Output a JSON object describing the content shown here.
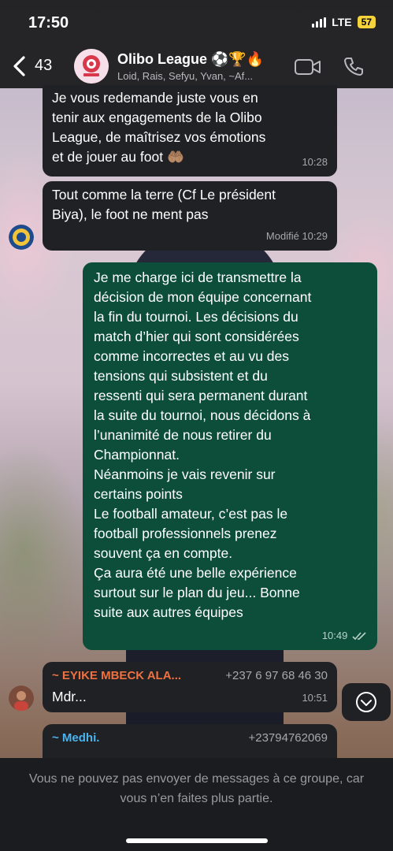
{
  "status_bar": {
    "time": "17:50",
    "network": "LTE",
    "battery": "57"
  },
  "header": {
    "back_count": "43",
    "group_name": "Olibo League ⚽🏆🔥",
    "members": "Loid, Rais, Sefyu, Yvan, ~Af..."
  },
  "messages": [
    {
      "direction": "in",
      "text": "Je vous redemande juste vous en\ntenir aux engagements de la Olibo\nLeague, de maîtrisez vos émotions\net de jouer au foot 🤲🏽",
      "time": "10:28"
    },
    {
      "direction": "in",
      "text": "Tout comme la terre (Cf Le président\nBiya), le foot ne ment pas",
      "edited": "Modifié",
      "time": "10:29"
    },
    {
      "direction": "out",
      "text": "Je me charge ici de transmettre la\ndécision de mon équipe concernant\nla fin du tournoi. Les décisions du\nmatch d’hier qui sont considérées\ncomme incorrectes et au vu des\ntensions qui subsistent et du\nressenti qui sera permanent durant\nla suite du tournoi, nous décidons à\nl’unanimité de nous retirer du\nChampionnat.\nNéanmoins je vais revenir sur\ncertains points\nLe football amateur, c’est pas le\nfootball professionnels prenez\nsouvent ça en compte.\nÇa aura été une belle expérience\nsurtout sur le plan du jeu... Bonne\nsuite aux autres équipes",
      "time": "10:49"
    },
    {
      "direction": "in",
      "sender": "~ EYIKE MBECK ALA...",
      "phone": "+237 6 97 68 46 30",
      "text": "Mdr...",
      "time": "10:51"
    },
    {
      "direction": "in",
      "sender": "~ Medhi.",
      "phone": "+23794762069",
      "text": ""
    }
  ],
  "blocked_notice": "Vous ne pouvez pas envoyer de messages à ce groupe, car vous n’en faites plus partie.",
  "colors": {
    "incoming_bubble": "#1f2124",
    "outgoing_bubble": "#0d4e3a",
    "sender_orange": "#f0713f",
    "sender_blue": "#4ab4f0",
    "battery": "#f5d33b"
  },
  "icons": [
    "back-chevron-icon",
    "video-call-icon",
    "phone-call-icon",
    "read-ticks-icon",
    "scroll-down-icon"
  ]
}
